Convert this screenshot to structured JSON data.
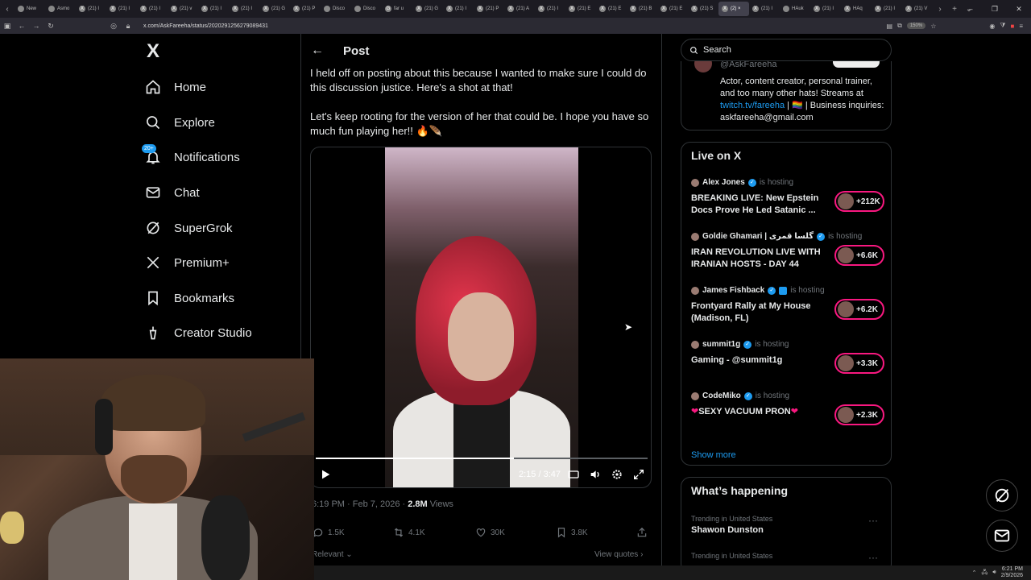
{
  "browser": {
    "tabs": [
      {
        "label": "New",
        "fav": ""
      },
      {
        "label": "Asmo",
        "fav": ""
      },
      {
        "label": "(21) I",
        "fav": "X"
      },
      {
        "label": "(21) I",
        "fav": "X"
      },
      {
        "label": "(21) I",
        "fav": "X"
      },
      {
        "label": "(21) v",
        "fav": "X"
      },
      {
        "label": "(21) I",
        "fav": "X"
      },
      {
        "label": "(21) I",
        "fav": "X"
      },
      {
        "label": "(21) G",
        "fav": "X"
      },
      {
        "label": "(21) P",
        "fav": "X"
      },
      {
        "label": "Disco",
        "fav": ""
      },
      {
        "label": "Disco",
        "fav": ""
      },
      {
        "label": "far u",
        "fav": "G"
      },
      {
        "label": "(21) G",
        "fav": "X"
      },
      {
        "label": "(21) I",
        "fav": "X"
      },
      {
        "label": "(21) P",
        "fav": "X"
      },
      {
        "label": "(21) A",
        "fav": "X"
      },
      {
        "label": "(21) I",
        "fav": "X"
      },
      {
        "label": "(21) E",
        "fav": "X"
      },
      {
        "label": "(21) E",
        "fav": "X"
      },
      {
        "label": "(21) B",
        "fav": "X"
      },
      {
        "label": "(21) E",
        "fav": "X"
      },
      {
        "label": "(21) S",
        "fav": "X"
      },
      {
        "label": "(2) ×",
        "fav": "X"
      },
      {
        "label": "(21) I",
        "fav": "X"
      },
      {
        "label": "HAuk",
        "fav": ""
      },
      {
        "label": "(21) I",
        "fav": "X"
      },
      {
        "label": "HAq",
        "fav": "X"
      },
      {
        "label": "(21) I",
        "fav": "X"
      },
      {
        "label": "(21) V",
        "fav": "X"
      }
    ],
    "active_tab_index": 23,
    "url": "x.com/AskFareeha/status/2020291256279089431",
    "zoom": "150%"
  },
  "nav": {
    "logo": "X",
    "notif_badge": "20+",
    "items": [
      {
        "label": "Home",
        "icon": "home-icon"
      },
      {
        "label": "Explore",
        "icon": "search-icon"
      },
      {
        "label": "Notifications",
        "icon": "bell-icon"
      },
      {
        "label": "Chat",
        "icon": "mail-icon"
      },
      {
        "label": "SuperGrok",
        "icon": "grok-icon"
      },
      {
        "label": "Premium+",
        "icon": "x-icon"
      },
      {
        "label": "Bookmarks",
        "icon": "bookmark-icon"
      },
      {
        "label": "Creator Studio",
        "icon": "creator-icon"
      }
    ]
  },
  "post": {
    "header_title": "Post",
    "text1": "I held off on posting about this because I wanted to make sure I could do this discussion justice. Here's a shot at that!",
    "text2": "Let's keep rooting for the version of her that could be. I hope you have so much fun playing her!! 🔥🪶",
    "video_time": "2:15 / 3:47",
    "video_progress_fraction": 0.597,
    "meta_time": "6:19 PM · Feb 7, 2026 · ",
    "meta_views": "2.8M",
    "meta_views_label": " Views",
    "replies": "1.5K",
    "reposts": "4.1K",
    "likes": "30K",
    "bookmarks": "3.8K",
    "relevant_label": "Relevant",
    "view_quotes_label": "View quotes"
  },
  "right": {
    "search_placeholder": "Search",
    "profile": {
      "handle": "@AskFareeha",
      "bio1": "Actor, content creator, personal trainer, and too many other hats! Streams at ",
      "bio_link": "twitch.tv/fareeha",
      "bio2": " | 🏳️‍🌈 | Business inquiries: askfareeha@gmail.com"
    },
    "live_title": "Live on X",
    "hosting_label": "is hosting",
    "live": [
      {
        "host": "Alex Jones",
        "title": "BREAKING LIVE: New Epstein Docs Prove He Led Satanic ...",
        "count": "+212K"
      },
      {
        "host": "Goldie Ghamari | گلسا قمری",
        "title": "IRAN REVOLUTION LIVE WITH IRANIAN HOSTS - DAY 44",
        "count": "+6.6K"
      },
      {
        "host": "James Fishback",
        "title": "Frontyard Rally at My House (Madison, FL)",
        "count": "+6.2K"
      },
      {
        "host": "summit1g",
        "title": "Gaming - @summit1g",
        "count": "+3.3K"
      },
      {
        "host": "CodeMiko",
        "title": "SEXY VACUUM PRON",
        "count": "+2.3K"
      }
    ],
    "show_more": "Show more",
    "happening_title": "What’s happening",
    "trends": [
      {
        "context": "Trending in United States",
        "name": "Shawon Dunston"
      },
      {
        "context": "Trending in United States",
        "name": ""
      }
    ]
  },
  "taskbar": {
    "time": "6:21 PM",
    "date": "2/9/2026"
  }
}
